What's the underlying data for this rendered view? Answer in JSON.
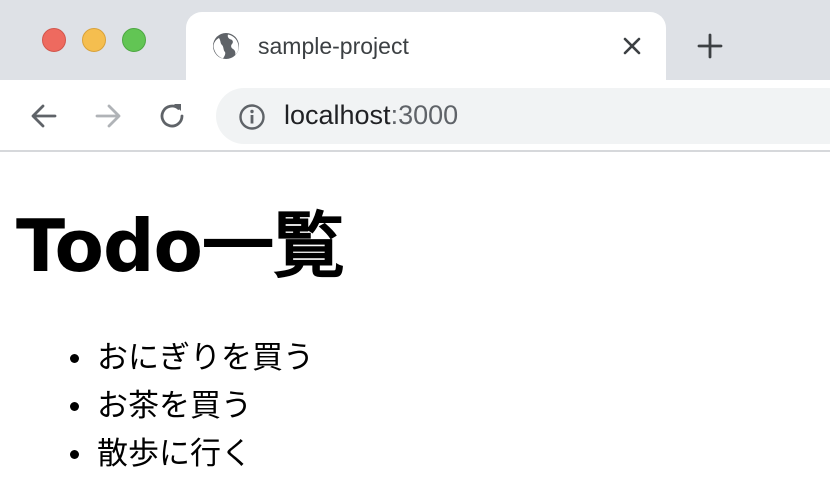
{
  "window": {
    "controls": [
      "close",
      "minimize",
      "maximize"
    ]
  },
  "tab": {
    "title": "sample-project",
    "favicon": "globe-icon",
    "close": "close-icon"
  },
  "new_tab": "plus-icon",
  "toolbar": {
    "back": "arrow-left-icon",
    "forward": "arrow-right-icon",
    "reload": "reload-icon"
  },
  "omnibox": {
    "icon": "info-icon",
    "host": "localhost",
    "port": ":3000"
  },
  "page": {
    "title": "Todo一覧",
    "todos": [
      "おにぎりを買う",
      "お茶を買う",
      "散歩に行く"
    ]
  },
  "colors": {
    "tabstrip": "#dee1e6",
    "omnibox": "#f1f3f4",
    "traffic_close": "#ee6a5f",
    "traffic_min": "#f5be4f",
    "traffic_max": "#62c554"
  }
}
